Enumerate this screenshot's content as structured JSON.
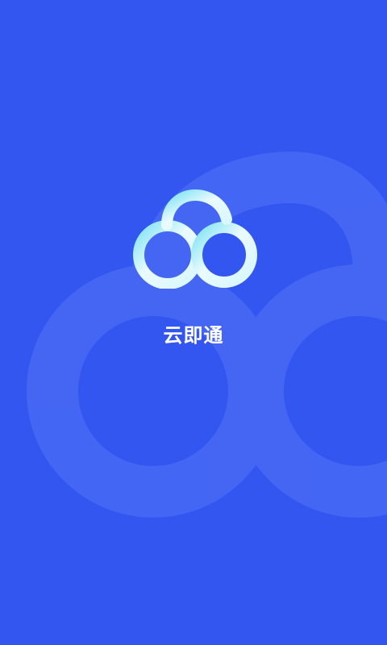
{
  "app": {
    "name": "云即通",
    "logo_icon": "cloud-logo-icon"
  },
  "colors": {
    "background": "#3355f0",
    "watermark": "#4a6cf5",
    "logo_light": "#e9fbff",
    "logo_accent": "#7fe3f3",
    "text": "#ffffff"
  }
}
